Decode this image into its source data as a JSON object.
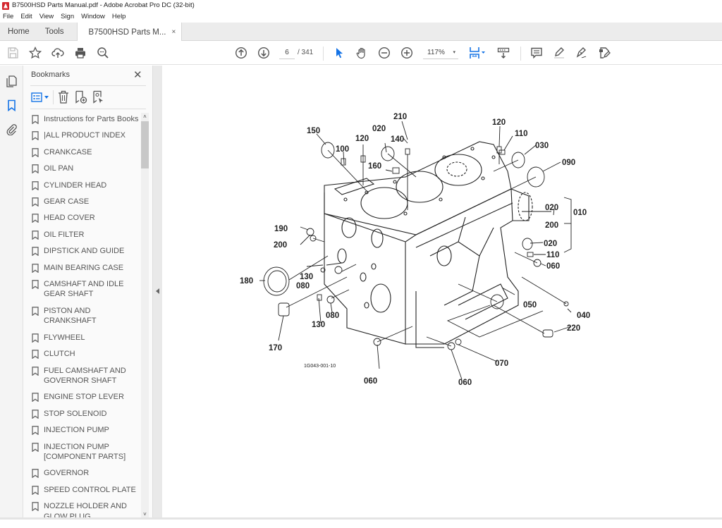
{
  "window": {
    "title": "B7500HSD Parts Manual.pdf - Adobe Acrobat Pro DC (32-bit)"
  },
  "menu": [
    "File",
    "Edit",
    "View",
    "Sign",
    "Window",
    "Help"
  ],
  "tabs": {
    "home": "Home",
    "tools": "Tools",
    "document": "B7500HSD Parts M...",
    "close": "×"
  },
  "toolbar": {
    "current_page": "6",
    "total_pages": "/ 341",
    "zoom": "117%",
    "zoom_arrow": "▾"
  },
  "bookmarks": {
    "title": "Bookmarks",
    "close": "✕",
    "items": [
      {
        "label": "Instructions for Parts Books"
      },
      {
        "label": "|ALL PRODUCT INDEX"
      },
      {
        "label": "CRANKCASE"
      },
      {
        "label": "OIL PAN"
      },
      {
        "label": "CYLINDER HEAD"
      },
      {
        "label": "GEAR CASE"
      },
      {
        "label": "HEAD COVER"
      },
      {
        "label": "OIL FILTER"
      },
      {
        "label": "DIPSTICK AND GUIDE"
      },
      {
        "label": "MAIN BEARING CASE"
      },
      {
        "label": "CAMSHAFT AND IDLE GEAR SHAFT"
      },
      {
        "label": "PISTON AND CRANKSHAFT"
      },
      {
        "label": "FLYWHEEL"
      },
      {
        "label": "CLUTCH"
      },
      {
        "label": "FUEL CAMSHAFT AND GOVERNOR SHAFT"
      },
      {
        "label": "ENGINE STOP LEVER"
      },
      {
        "label": "STOP SOLENOID"
      },
      {
        "label": "INJECTION PUMP"
      },
      {
        "label": "INJECTION PUMP [COMPONENT PARTS]"
      },
      {
        "label": "GOVERNOR"
      },
      {
        "label": "SPEED CONTROL PLATE"
      },
      {
        "label": "NOZZLE HOLDER AND GLOW PLUG"
      }
    ],
    "scroll_up": "˄",
    "scroll_down": "˅"
  },
  "diagram": {
    "figure_id": "1G043-001-10",
    "callouts": {
      "c210": "210",
      "c150": "150",
      "c020a": "020",
      "c140": "140",
      "c120a": "120",
      "c100": "100",
      "c160": "160",
      "c120b": "120",
      "c110a": "110",
      "c030": "030",
      "c090": "090",
      "c020b": "020",
      "c010": "010",
      "c200a": "200",
      "c190": "190",
      "c200b": "200",
      "c020c": "020",
      "c110b": "110",
      "c060a": "060",
      "c180": "180",
      "c130a": "130",
      "c080a": "080",
      "c050": "050",
      "c040": "040",
      "c130b": "130",
      "c080b": "080",
      "c220": "220",
      "c170": "170",
      "c070": "070",
      "c060b": "060",
      "c060c": "060"
    }
  }
}
